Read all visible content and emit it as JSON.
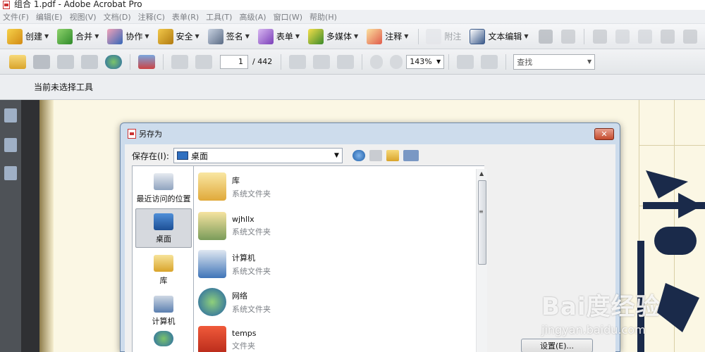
{
  "window": {
    "title": "组合 1.pdf - Adobe Acrobat Pro"
  },
  "menu": [
    "文件(F)",
    "编辑(E)",
    "视图(V)",
    "文档(D)",
    "注释(C)",
    "表单(R)",
    "工具(T)",
    "高级(A)",
    "窗口(W)",
    "帮助(H)"
  ],
  "toolbar1": {
    "create": "创建",
    "combine": "合并",
    "collaborate": "协作",
    "secure": "安全",
    "sign": "签名",
    "forms": "表单",
    "multimedia": "多媒体",
    "comment": "注释",
    "attach": "附注",
    "text_edit": "文本编辑"
  },
  "toolbar2": {
    "page_current": "1",
    "page_total": "/ 442",
    "zoom": "143%",
    "find_placeholder": "查找"
  },
  "toolbar3": {
    "status": "当前未选择工具"
  },
  "dialog": {
    "title": "另存为",
    "save_in_label": "保存在(I):",
    "location": "桌面",
    "places": [
      "最近访问的位置",
      "桌面",
      "库",
      "计算机",
      "网络"
    ],
    "files": [
      {
        "name": "库",
        "type": "系统文件夹"
      },
      {
        "name": "wjhllx",
        "type": "系统文件夹"
      },
      {
        "name": "计算机",
        "type": "系统文件夹"
      },
      {
        "name": "网络",
        "type": "系统文件夹"
      },
      {
        "name": "temps",
        "type": "文件夹"
      }
    ],
    "settings_button": "设置(E)...",
    "close_glyph": "✕"
  },
  "watermark": {
    "brand": "Bai度经验",
    "url": "jingyan.baidu.com"
  },
  "colors": {
    "dialog_frame": "#cddcec",
    "close_red": "#c34a2c",
    "doc_page": "#fbf7e4",
    "nav_dark": "#4e5257"
  }
}
